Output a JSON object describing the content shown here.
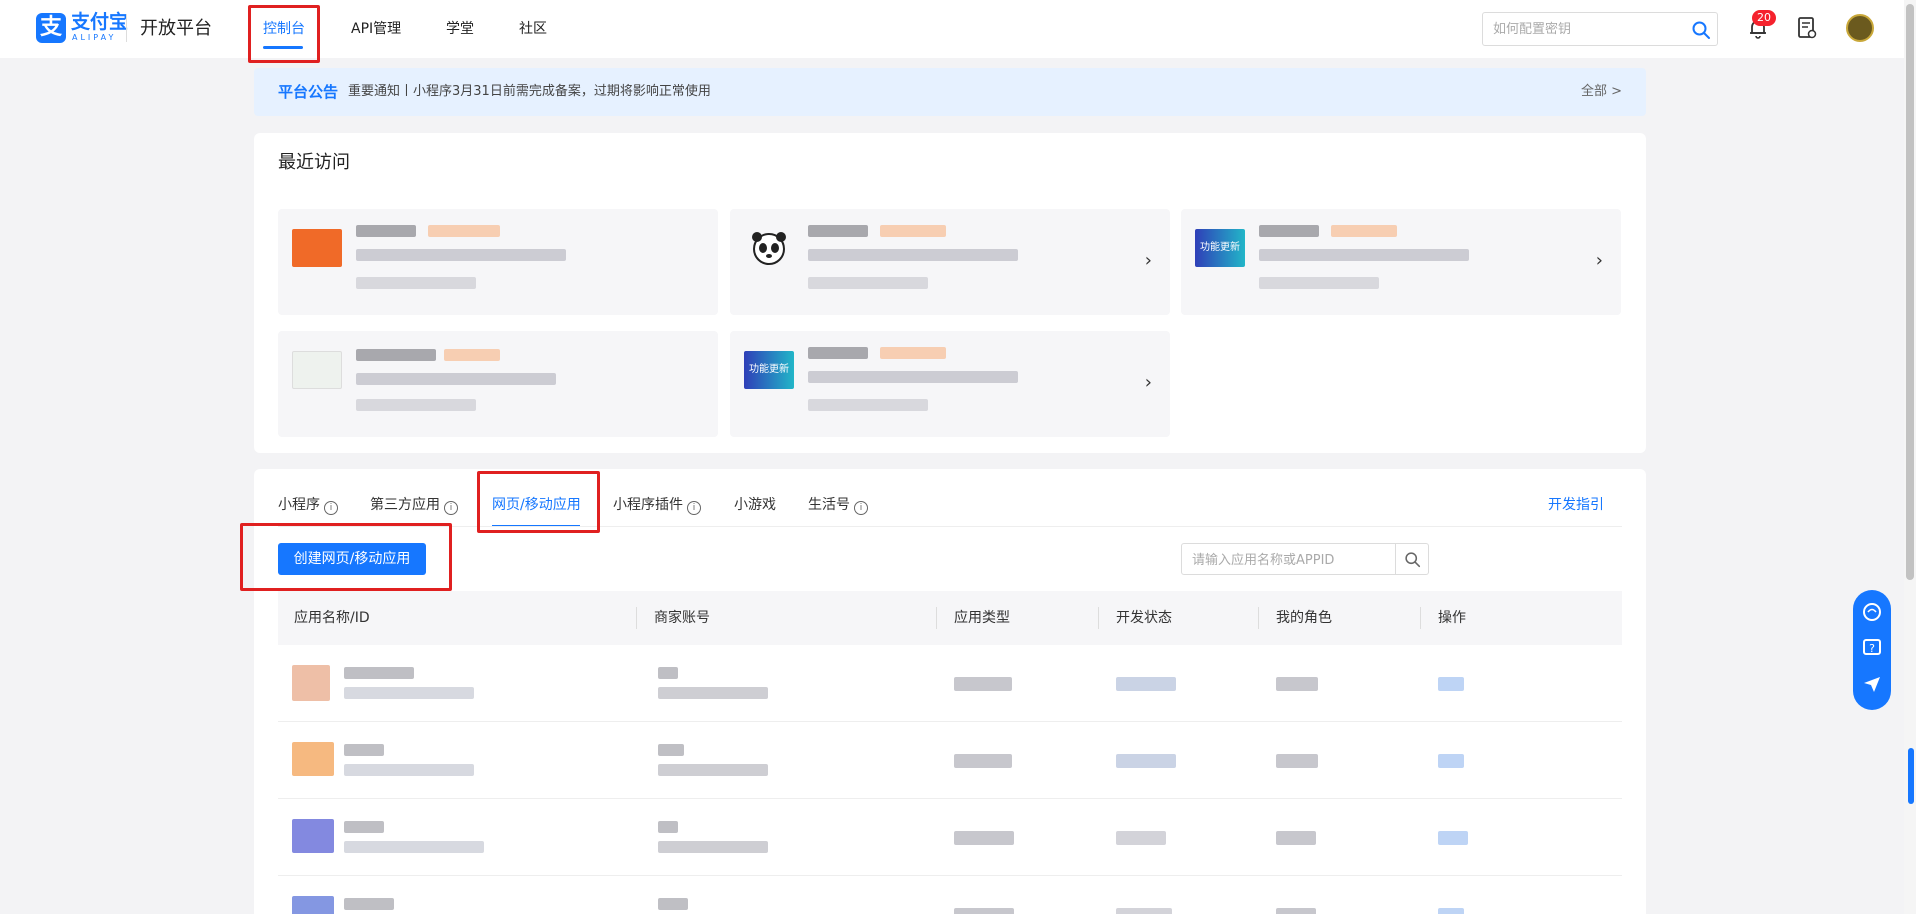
{
  "header": {
    "logo_mark": "支",
    "logo_text": "支付宝",
    "logo_sub": "ALIPAY",
    "platform_name": "开放平台",
    "nav": [
      {
        "label": "控制台",
        "active": true
      },
      {
        "label": "API管理"
      },
      {
        "label": "学堂"
      },
      {
        "label": "社区"
      }
    ],
    "search_placeholder": "如何配置密钥",
    "notification_count": "20"
  },
  "notice": {
    "title": "平台公告",
    "text": "重要通知丨小程序3月31日前需完成备案，过期将影响正常使用",
    "all_label": "全部 >"
  },
  "recent": {
    "title": "最近访问",
    "tiles": [
      {
        "thumb_color": "#f06a28",
        "has_arrow": false,
        "thumb_icon": "orange-promo-thumbnail"
      },
      {
        "thumb_color": "#ffffff",
        "has_arrow": true,
        "thumb_icon": "panda-icon"
      },
      {
        "thumb_color": "#2f3fb8",
        "thumb_label": "功能更新",
        "has_arrow": true
      },
      {
        "thumb_color": "#eef2ee",
        "has_arrow": false,
        "thumb_icon": "screenshot-thumbnail"
      },
      {
        "thumb_color": "#2f3fb8",
        "thumb_label": "功能更新",
        "has_arrow": true
      }
    ],
    "arrow": "›"
  },
  "tabs": {
    "items": [
      {
        "label": "小程序",
        "info": true
      },
      {
        "label": "第三方应用",
        "info": true
      },
      {
        "label": "网页/移动应用",
        "active": true
      },
      {
        "label": "小程序插件",
        "info": true
      },
      {
        "label": "小游戏"
      },
      {
        "label": "生活号",
        "info": true
      }
    ],
    "dev_guide": "开发指引",
    "info_glyph": "i"
  },
  "toolbar": {
    "create_button": "创建网页/移动应用",
    "search_placeholder": "请输入应用名称或APPID"
  },
  "table": {
    "columns": [
      "应用名称/ID",
      "商家账号",
      "应用类型",
      "开发状态",
      "我的角色",
      "操作"
    ]
  },
  "colors": {
    "accent": "#1677ff",
    "highlight_box": "#e02020",
    "badge": "#f5222d"
  }
}
